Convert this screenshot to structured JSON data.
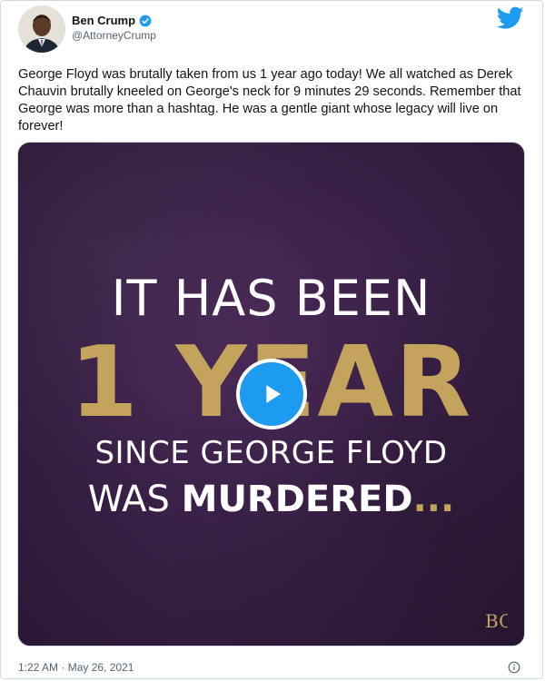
{
  "user": {
    "display_name": "Ben Crump",
    "handle": "@AttorneyCrump"
  },
  "tweet": {
    "text": "George Floyd was brutally taken from us 1 year ago today! We all watched as Derek Chauvin brutally kneeled on George's neck for 9 minutes 29 seconds. Remember that George was more than a hashtag. He was a gentle giant whose legacy will live on forever!",
    "timestamp": "1:22 AM · May 26, 2021"
  },
  "media": {
    "line1": "IT HAS BEEN",
    "line2": "1 YEAR",
    "line3": "SINCE GEORGE FLOYD",
    "line4_a": "WAS ",
    "line4_b": "MURDERED",
    "line4_c": "...",
    "logo_text": "BC"
  },
  "icons": {
    "verified": "verified-badge-icon",
    "brand": "twitter-bird-icon",
    "play": "play-icon",
    "info": "info-icon"
  },
  "colors": {
    "twitter_blue": "#1d9bf0",
    "media_purple": "#3b2148",
    "gold": "#c4a45c",
    "text": "#0f1419",
    "muted": "#536471"
  }
}
